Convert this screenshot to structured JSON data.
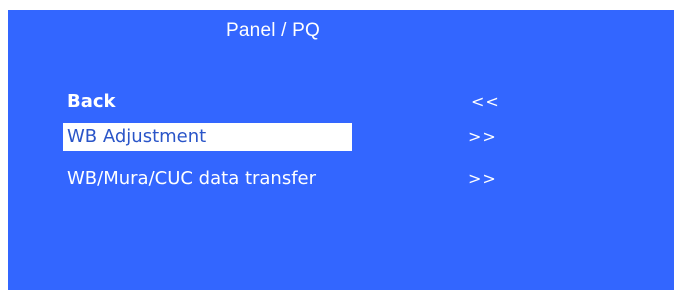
{
  "panel": {
    "title": "Panel / PQ",
    "background": "#3366ff"
  },
  "menu": {
    "items": [
      {
        "label": "Back",
        "arrow": "<<",
        "selected": false
      },
      {
        "label": "WB Adjustment",
        "arrow": ">>",
        "selected": true
      },
      {
        "label": "WB/Mura/CUC data transfer",
        "arrow": ">>",
        "selected": false
      }
    ]
  },
  "colors": {
    "panel_bg": "#3366ff",
    "text": "#ffffff",
    "highlight_bg": "#ffffff",
    "highlight_text": "#2a55c8"
  }
}
